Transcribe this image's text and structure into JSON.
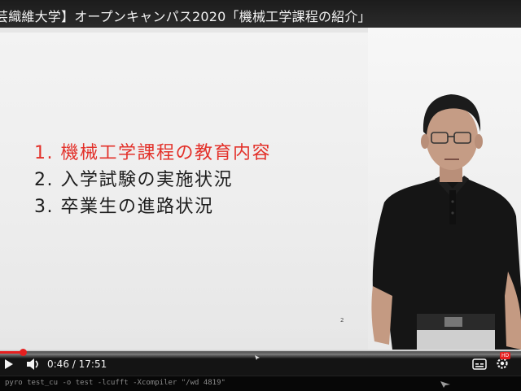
{
  "video": {
    "title": "芸織維大学】オープンキャンパス2020「機械工学課程の紹介」"
  },
  "slide": {
    "items": [
      {
        "label": "1. 機械工学課程の教育内容",
        "active": true
      },
      {
        "label": "2. 入学試験の実施状況",
        "active": false
      },
      {
        "label": "3. 卒業生の進路状況",
        "active": false
      }
    ],
    "page_number": "2"
  },
  "player": {
    "time_current": "0:46",
    "time_separator": " / ",
    "time_total": "17:51",
    "progress_fraction": 0.043,
    "progress_color": "#e51f1f",
    "hd_badge": "HD",
    "icons": [
      "play-icon",
      "volume-icon",
      "cc-icon",
      "settings-icon"
    ]
  },
  "terminal": {
    "text": "pyro test_cu -o test -lcufft -Xcompiler \"/wd 4819\""
  },
  "colors": {
    "active_item": "#e3312a",
    "text": "#1d1d1d",
    "shirt": "#151515"
  }
}
